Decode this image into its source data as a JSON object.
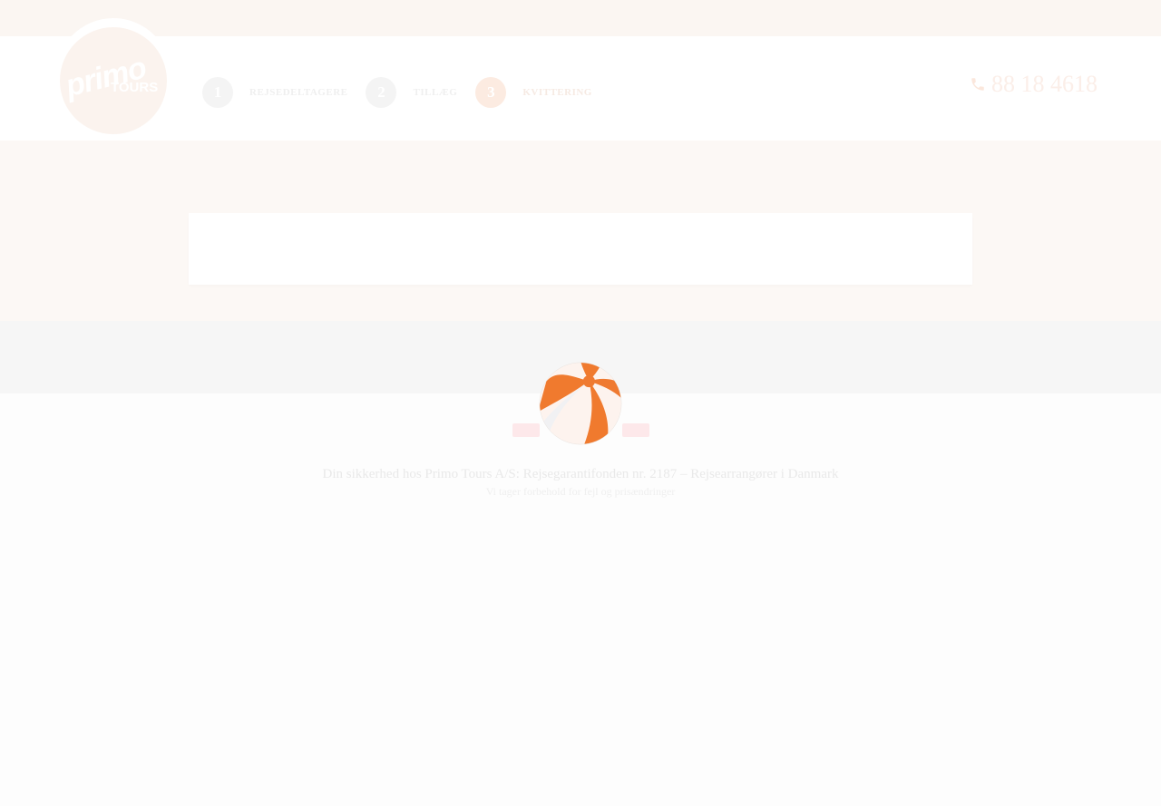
{
  "header": {
    "logo": {
      "primary": "primo",
      "secondary": "TOURS"
    },
    "steps": [
      {
        "number": "1",
        "label": "REJSEDELTAGERE",
        "active": false
      },
      {
        "number": "2",
        "label": "TILLÆG",
        "active": false
      },
      {
        "number": "3",
        "label": "KVITTERING",
        "active": true
      }
    ],
    "phone": {
      "icon": "phone-icon",
      "number": "88 18 4618"
    }
  },
  "loading": {
    "icon": "beach-ball-icon"
  },
  "footer": {
    "main_text": "Din sikkerhed hos Primo Tours A/S: Rejsegarantifonden nr. 2187 – Rejsearrangører i Danmark",
    "sub_text": "Vi tager forbehold for fejl og prisændringer"
  },
  "colors": {
    "accent": "#f07a2e",
    "accent_light": "#fcebe1",
    "page_tint": "#fcf8f5"
  }
}
